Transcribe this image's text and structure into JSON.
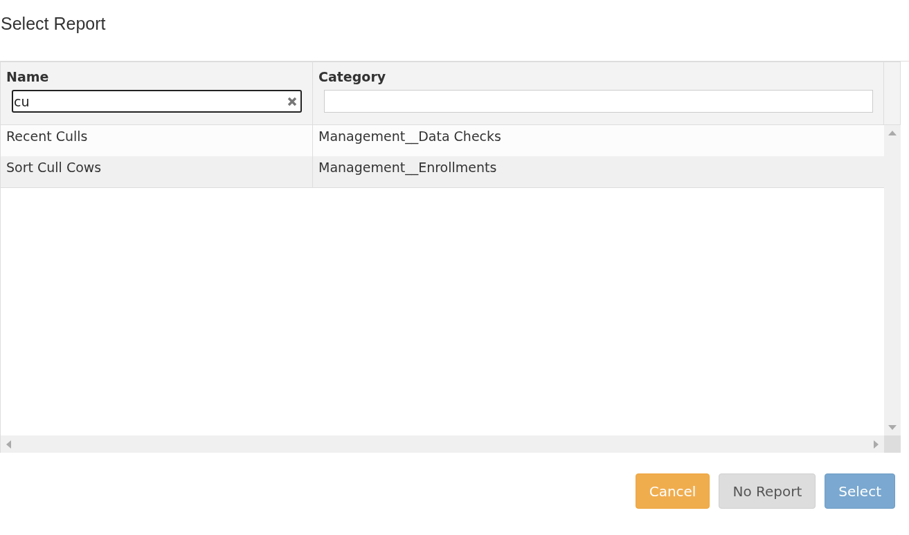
{
  "title": "Select Report",
  "table": {
    "columns": [
      {
        "label": "Name",
        "filter": {
          "value": "cu",
          "focused": true,
          "clearable": true
        }
      },
      {
        "label": "Category",
        "filter": {
          "focused": false,
          "clearable": false
        }
      }
    ],
    "rows": [
      [
        "Recent Culls",
        "Management__Data Checks"
      ],
      [
        "Sort Cull Cows",
        "Management__Enrollments"
      ]
    ]
  },
  "buttons": [
    {
      "label": "Cancel",
      "kind": "warning"
    },
    {
      "label": "No Report",
      "kind": "default"
    },
    {
      "label": "Select",
      "kind": "primary"
    }
  ]
}
